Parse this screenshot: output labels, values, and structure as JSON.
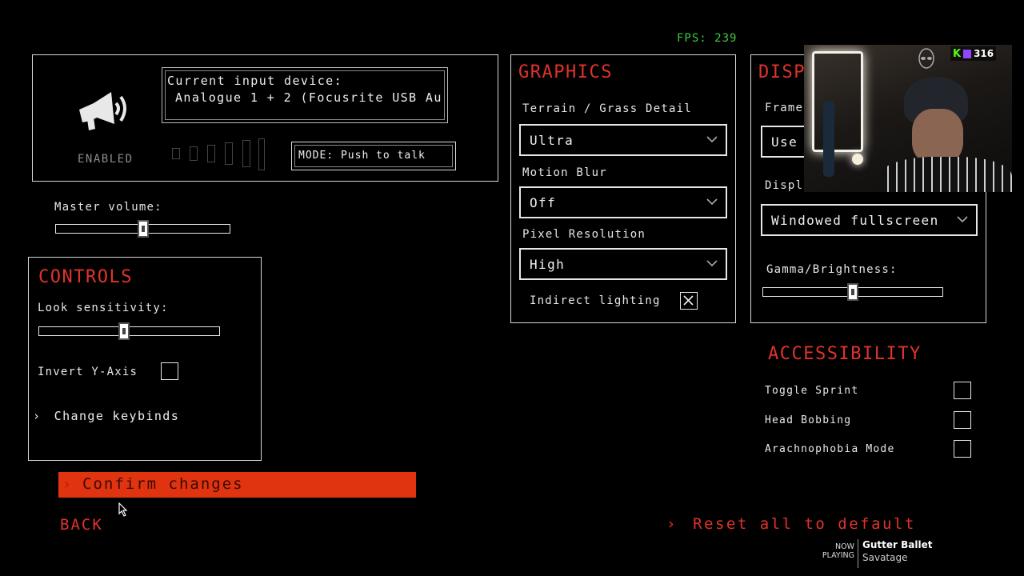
{
  "fps": "FPS: 239",
  "audio": {
    "input_label": "Current input device:",
    "input_value": "Analogue 1 + 2 (Focusrite USB Au",
    "enabled_label": "ENABLED",
    "mode_label": "MODE: Push to talk",
    "master_volume_label": "Master volume:",
    "master_volume_level": 0.5
  },
  "controls": {
    "title": "CONTROLS",
    "look_sensitivity_label": "Look sensitivity:",
    "look_sensitivity_level": 0.47,
    "invert_y_label": "Invert Y-Axis",
    "invert_y_checked": false,
    "change_keybinds_label": "Change keybinds"
  },
  "graphics": {
    "title": "GRAPHICS",
    "terrain_label": "Terrain / Grass Detail",
    "terrain_value": "Ultra",
    "motion_blur_label": "Motion Blur",
    "motion_blur_value": "Off",
    "pixel_res_label": "Pixel Resolution",
    "pixel_res_value": "High",
    "indirect_lighting_label": "Indirect lighting",
    "indirect_lighting_checked": true
  },
  "display": {
    "title_partial": "DISP",
    "frame_label_partial": "Frame",
    "frame_value_partial": "Use",
    "display_label_partial": "Displa",
    "display_mode_value": "Windowed fullscreen",
    "gamma_label": "Gamma/Brightness:",
    "gamma_level": 0.5
  },
  "accessibility": {
    "title": "ACCESSIBILITY",
    "items": [
      {
        "label": "Toggle Sprint",
        "checked": false
      },
      {
        "label": "Head Bobbing",
        "checked": false
      },
      {
        "label": "Arachnophobia Mode",
        "checked": false
      }
    ]
  },
  "footer": {
    "confirm_label": "Confirm changes",
    "back_label": "BACK",
    "reset_label": "Reset all to default"
  },
  "overlay": {
    "viewer_count": "316",
    "now_playing_label": "NOW PLAYING",
    "song_title": "Gutter Ballet",
    "song_artist": "Savatage"
  },
  "colors": {
    "accent": "#e0332b",
    "confirm_bg": "#e03410"
  }
}
